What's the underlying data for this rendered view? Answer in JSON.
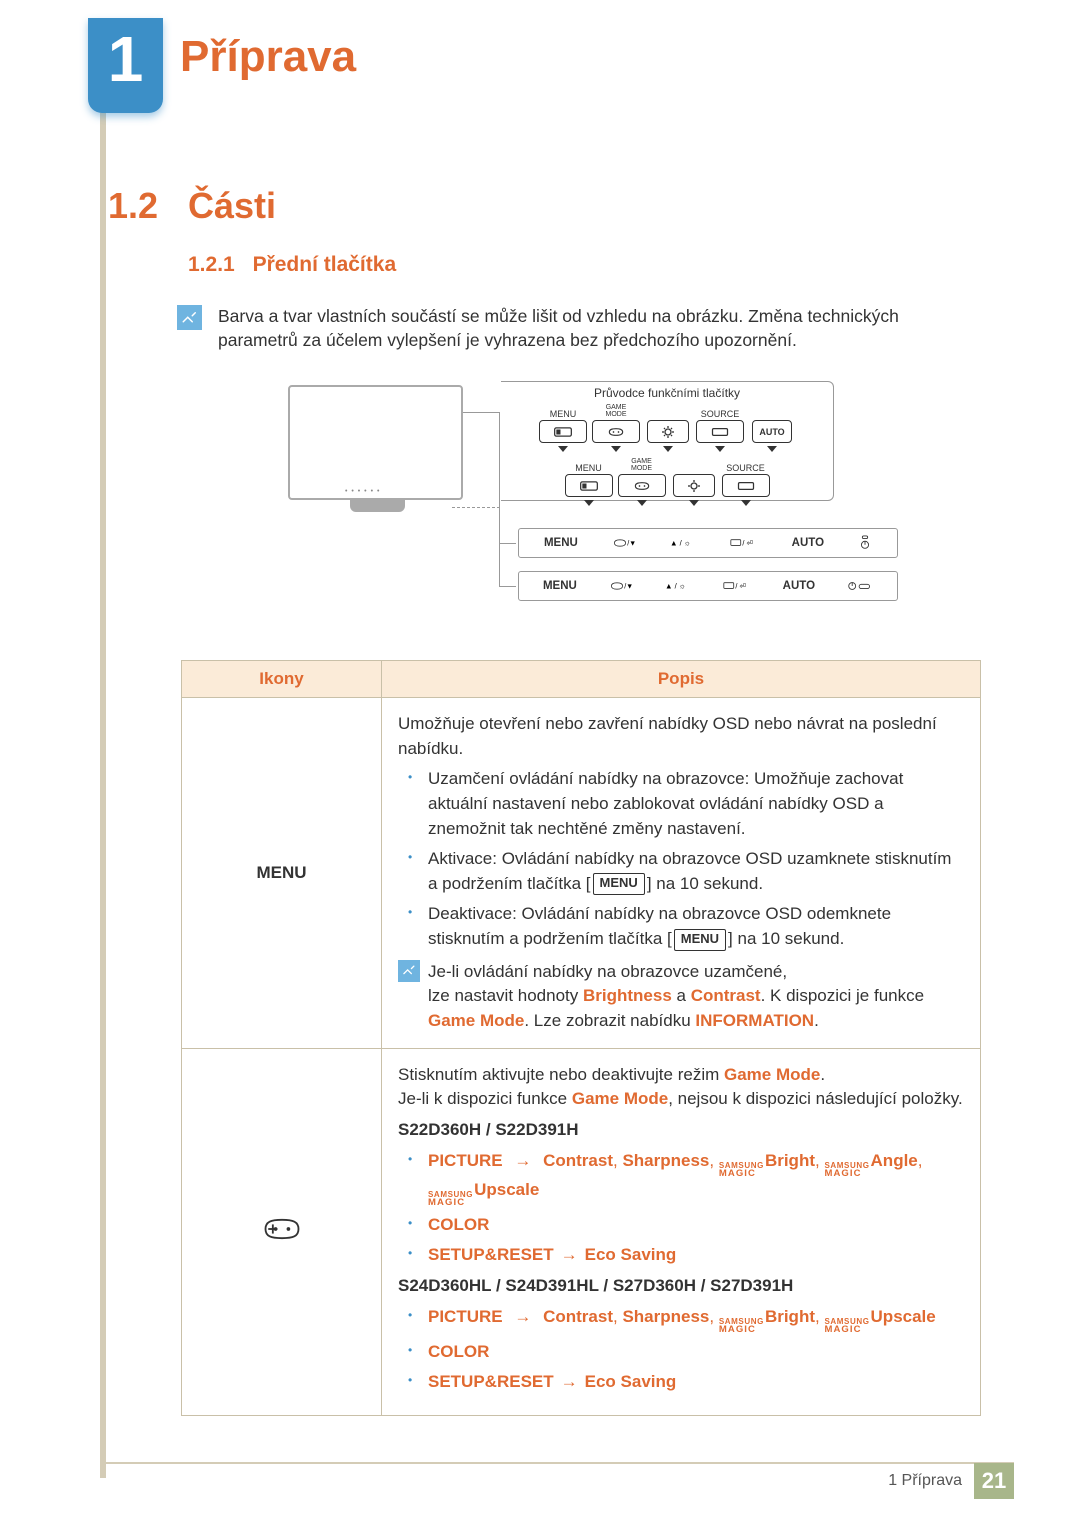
{
  "chapter": {
    "number": "1",
    "title": "Příprava"
  },
  "section": {
    "number": "1.2",
    "title": "Části"
  },
  "subsection": {
    "number": "1.2.1",
    "title": "Přední tlačítka"
  },
  "note_text": "Barva a tvar vlastních součástí se může lišit od vzhledu na obrázku. Změna technických parametrů za účelem vylepšení je vyhrazena bez předchozího upozornění.",
  "diagram": {
    "guide_title": "Průvodce funkčními tlačítky",
    "labels": {
      "menu": "MENU",
      "game_top": "GAME",
      "game_bottom": "MODE",
      "source": "SOURCE",
      "auto": "AUTO"
    }
  },
  "table": {
    "headers": {
      "icons": "Ikony",
      "desc": "Popis"
    },
    "row1": {
      "icon_label": "MENU",
      "intro": "Umožňuje otevření nebo zavření nabídky OSD nebo návrat na poslední nabídku.",
      "bullets": [
        "Uzamčení ovládání nabídky na obrazovce: Umožňuje zachovat aktuální nastavení nebo zablokovat ovládání nabídky OSD a znemožnit tak nechtěné změny nastavení.",
        "Aktivace: Ovládání nabídky na obrazovce OSD uzamknete stisknutím a podržením tlačítka [",
        "Deaktivace: Ovládání nabídky na obrazovce OSD odemknete stisknutím a podržením tlačítka ["
      ],
      "bullet_suffix_activate": "] na 10 sekund.",
      "bullet_suffix_deactivate": "] na 10 sekund.",
      "menu_pill": "MENU",
      "locked_note_1": "Je-li ovládání nabídky na obrazovce uzamčené,",
      "locked_note_2a": "lze nastavit hodnoty ",
      "locked_brightness": "Brightness",
      "locked_and": " a ",
      "locked_contrast": "Contrast",
      "locked_note_2b": ". K dispozici je funkce ",
      "locked_game_mode": "Game Mode",
      "locked_note_3a": ". Lze zobrazit nabídku ",
      "locked_information": "INFORMATION",
      "locked_note_3b": "."
    },
    "row2": {
      "intro_a": "Stisknutím aktivujte nebo deaktivujte režim ",
      "game_mode": "Game Mode",
      "intro_b": ".",
      "line2a": "Je-li k dispozici funkce ",
      "line2b": ", nejsou k dispozici následující položky.",
      "models1": "S22D360H / S22D391H",
      "models2": "S24D360HL / S24D391HL / S27D360H / S27D391H",
      "picture": "PICTURE",
      "contrast": "Contrast",
      "sharpness": "Sharpness",
      "bright": "Bright",
      "angle": "Angle",
      "upscale": "Upscale",
      "color": "COLOR",
      "setup_reset": "SETUP&RESET",
      "eco": "Eco Saving",
      "brand_top": "SAMSUNG",
      "brand_bottom": "MAGIC",
      "comma_sep": ", ",
      "arrow": "→"
    }
  },
  "footer": {
    "text": "1 Příprava",
    "page": "21"
  }
}
